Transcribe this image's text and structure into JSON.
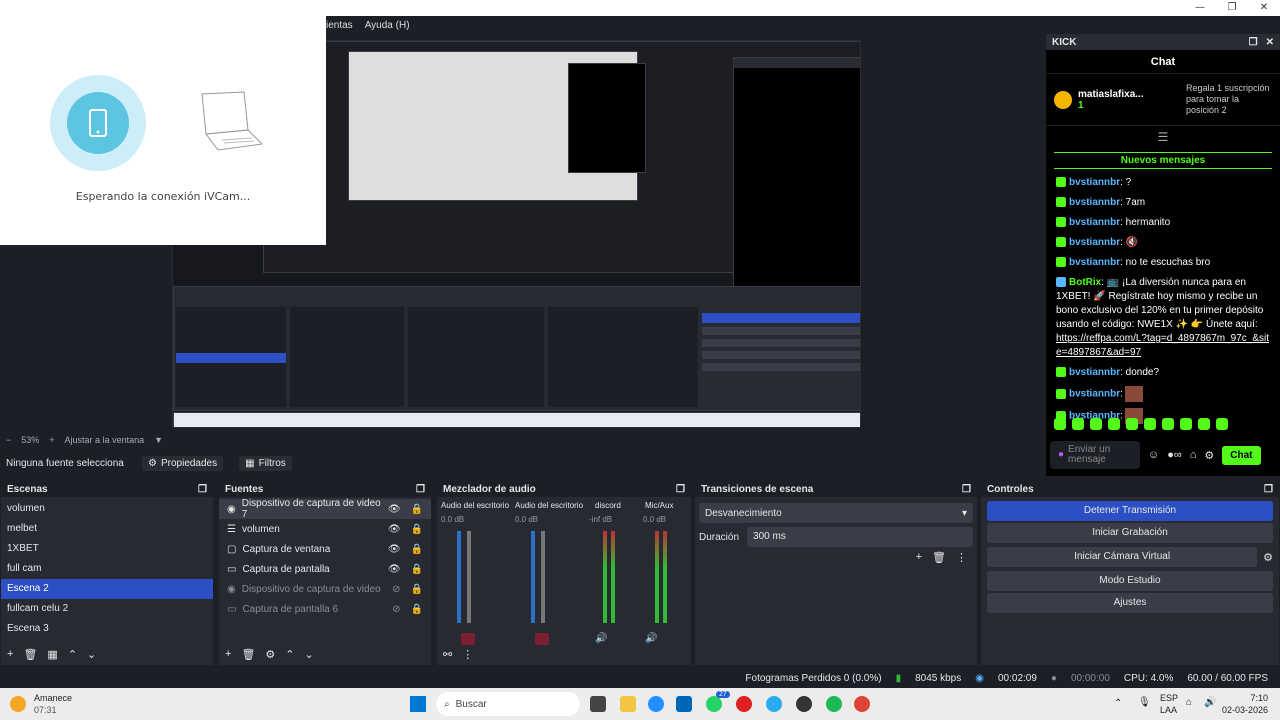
{
  "window": {
    "minimize_glyph": "—",
    "maximize_glyph": "❐",
    "close_glyph": "✕"
  },
  "menu": {
    "items": [
      "ientas",
      "Ayuda (H)"
    ]
  },
  "ivcam": {
    "status": "Esperando la conexión iVCam..."
  },
  "chat": {
    "dock_title": "KICK",
    "title": "Chat",
    "pinned_user": "matiaslafixa...",
    "pinned_count": "1",
    "gift_text": "Regala 1 suscripción para tomar la posición 2",
    "new_messages": "Nuevos mensajes",
    "messages": [
      {
        "user": "bvstiannbr",
        "text": ": ?"
      },
      {
        "user": "bvstiannbr",
        "text": ": 7am"
      },
      {
        "user": "bvstiannbr",
        "text": ": hermanito"
      },
      {
        "user": "bvstiannbr",
        "text": ": 🔇"
      },
      {
        "user": "bvstiannbr",
        "text": ": no te escuchas bro"
      },
      {
        "user": "BotRix",
        "text": ": 📺 ¡La diversión nunca para en 1XBET! 🚀 Regístrate hoy mismo y recibe un bono exclusivo del 120% en tu primer depósito usando el código: NWE1X ✨ 👉 Únete aquí:"
      },
      {
        "user": "bvstiannbr",
        "text": ": donde?"
      },
      {
        "user": "bvstiannbr",
        "text": ":"
      },
      {
        "user": "bvstiannbr",
        "text": ":"
      }
    ],
    "link": "https://reffpa.com/L?tag=d_4897867m_97c_&site=4897867&ad=97",
    "send_placeholder": "Enviar un mensaje",
    "send_button": "Chat"
  },
  "zoom": {
    "value": "53%",
    "fit_label": "Ajustar a la ventana"
  },
  "source_toolbar": {
    "no_source": "Ninguna fuente selecciona",
    "properties": "Propiedades",
    "filters": "Filtros"
  },
  "scenes": {
    "title": "Escenas",
    "items": [
      "volumen",
      "melbet",
      "1XBET",
      "full cam",
      "Escena 2",
      "fullcam celu 2",
      "Escena 3"
    ],
    "selected_index": 4
  },
  "sources": {
    "title": "Fuentes",
    "items": [
      {
        "name": "Dispositivo de captura de video 7",
        "visible": true
      },
      {
        "name": "volumen",
        "visible": true
      },
      {
        "name": "Captura de ventana",
        "visible": true
      },
      {
        "name": "Captura de pantalla",
        "visible": true
      },
      {
        "name": "Dispositivo de captura de video",
        "visible": false
      },
      {
        "name": "Captura de pantalla 6",
        "visible": false
      }
    ]
  },
  "mixer": {
    "title": "Mezclador de audio",
    "channels": [
      {
        "name": "Audio del escritorio",
        "level": "0.0 dB",
        "muted": true
      },
      {
        "name": "Audio del escritorio",
        "level": "0.0 dB",
        "muted": true
      },
      {
        "name": "discord",
        "level": "-inf dB",
        "muted": false
      },
      {
        "name": "Mic/Aux",
        "level": "0.0 dB",
        "muted": false
      }
    ],
    "scale": [
      "5",
      "0",
      "-5",
      "-10",
      "-15",
      "-20",
      "-25",
      "-30",
      "-35",
      "-40",
      "-45",
      "-50",
      "-55",
      "-60"
    ]
  },
  "transitions": {
    "title": "Transiciones de escena",
    "selected": "Desvanecimiento",
    "duration_label": "Duración",
    "duration_value": "300 ms"
  },
  "controls": {
    "title": "Controles",
    "buttons": [
      "Detener Transmisión",
      "Iniciar Grabación",
      "Iniciar Cámara Virtual",
      "Modo Estudio",
      "Ajustes"
    ]
  },
  "status": {
    "dropped": "Fotogramas Perdidos 0 (0.0%)",
    "bitrate": "8045 kbps",
    "stream_time": "00:02:09",
    "rec_time": "00:00:00",
    "cpu": "CPU: 4.0%",
    "fps": "60.00 / 60.00 FPS"
  },
  "taskbar": {
    "weather_title": "Amanece",
    "weather_time": "07:31",
    "search_placeholder": "Buscar",
    "lang": "ESP",
    "lang_sub": "LAA",
    "time": "7:10",
    "date": "02-03-2026",
    "whatsapp_badge": "27"
  }
}
